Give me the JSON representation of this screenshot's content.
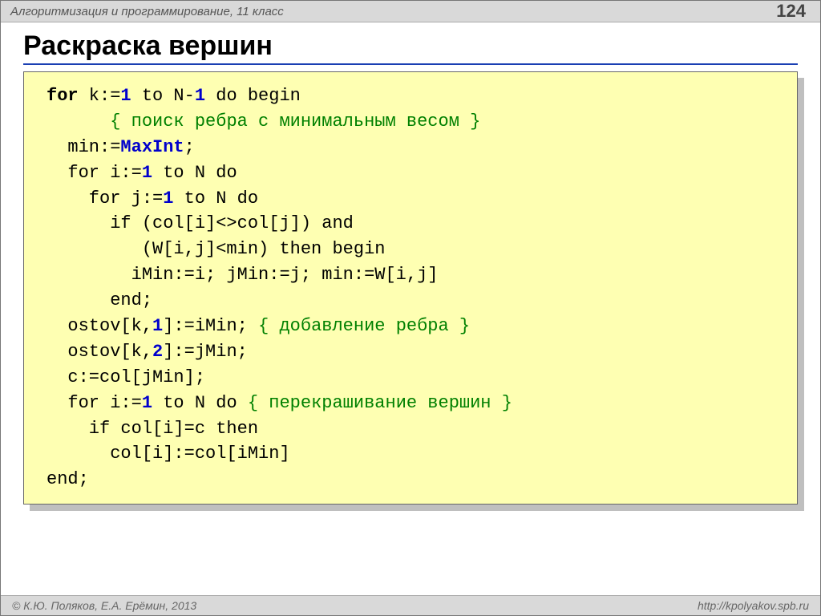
{
  "header": {
    "subject": "Алгоритмизация и программирование, 11 класс",
    "page_number": "124"
  },
  "title": "Раскраска вершин",
  "code": {
    "l1": {
      "t0": "for",
      "t1": " k:=",
      "t2": "1",
      "t3": " to N-",
      "t4": "1",
      "t5": " do begin"
    },
    "l2": "{ поиск ребра с минимальным весом }",
    "l3": {
      "t0": "  min:=",
      "t1": "MaxInt",
      "t2": ";"
    },
    "l4": {
      "t0": "  for i:=",
      "t1": "1",
      "t2": " to N do"
    },
    "l5": {
      "t0": "    for j:=",
      "t1": "1",
      "t2": " to N do"
    },
    "l6": "      if (col[i]<>col[j]) and",
    "l7": "         (W[i,j]<min) then begin",
    "l8": "        iMin:=i; jMin:=j; min:=W[i,j]",
    "l9": "      end;",
    "l10": {
      "t0": "  ostov[k,",
      "t1": "1",
      "t2": "]:=iMin; ",
      "t3": "{ добавление ребра }"
    },
    "l11": {
      "t0": "  ostov[k,",
      "t1": "2",
      "t2": "]:=jMin;"
    },
    "l12": "  c:=col[jMin];",
    "l13": {
      "t0": "  for i:=",
      "t1": "1",
      "t2": " to N do ",
      "t3": "{ перекрашивание вершин }"
    },
    "l14": "    if col[i]=c then",
    "l15": "      col[i]:=col[iMin]",
    "l16": "end;"
  },
  "footer": {
    "left": "© К.Ю. Поляков, Е.А. Ерёмин, 2013",
    "right": "http://kpolyakov.spb.ru"
  }
}
